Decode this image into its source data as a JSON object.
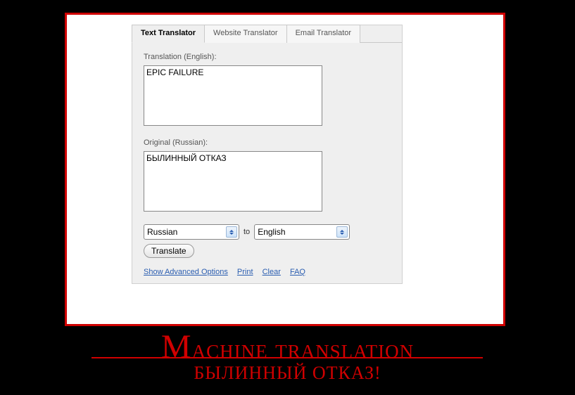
{
  "tabs": {
    "text": "Text Translator",
    "website": "Website Translator",
    "email": "Email Translator"
  },
  "labels": {
    "translation": "Translation (English):",
    "original": "Original (Russian):",
    "to": "to"
  },
  "textarea": {
    "translation_value": "EPIC FAILURE",
    "original_value": "БЫЛИННЫЙ ОТКАЗ"
  },
  "selects": {
    "from": "Russian",
    "to": "English"
  },
  "buttons": {
    "translate": "Translate"
  },
  "links": {
    "advanced": "Show Advanced Options",
    "print": "Print",
    "clear": "Clear",
    "faq": "FAQ"
  },
  "poster": {
    "title_first": "M",
    "title_rest": "achine translation",
    "subtitle": "БЫЛИННЫЙ ОТКАЗ!"
  }
}
